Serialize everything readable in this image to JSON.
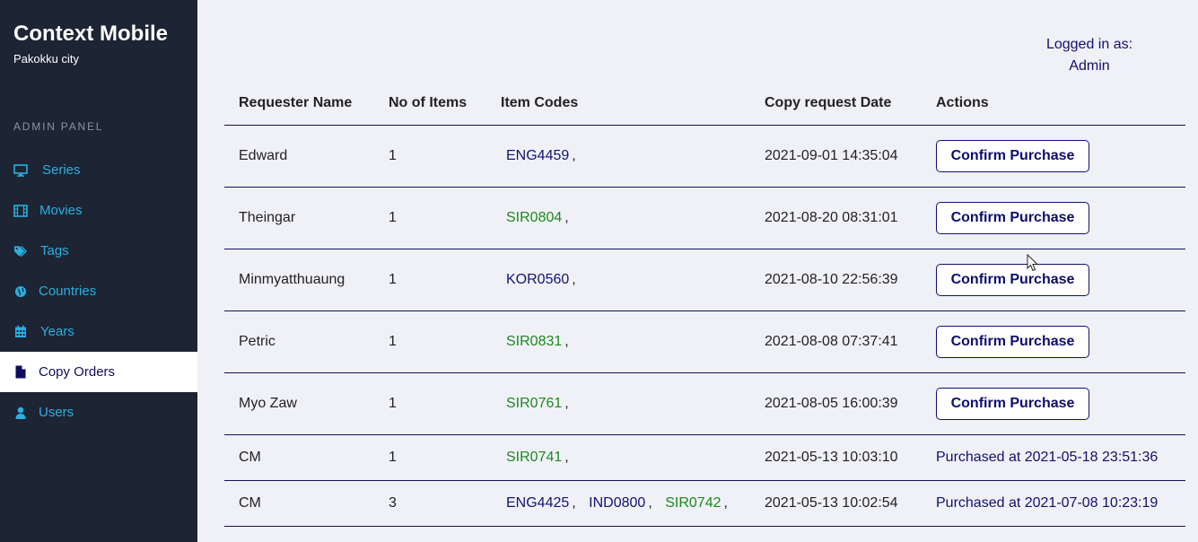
{
  "app": {
    "title": "Context Mobile",
    "subtitle": "Pakokku city"
  },
  "sidebar": {
    "section_label": "ADMIN PANEL",
    "items": [
      {
        "label": "Series",
        "icon": "monitor-icon"
      },
      {
        "label": "Movies",
        "icon": "film-icon"
      },
      {
        "label": "Tags",
        "icon": "tags-icon"
      },
      {
        "label": "Countries",
        "icon": "globe-icon"
      },
      {
        "label": "Years",
        "icon": "calendar-icon"
      },
      {
        "label": "Copy Orders",
        "icon": "file-icon",
        "active": true
      },
      {
        "label": "Users",
        "icon": "user-icon"
      }
    ]
  },
  "header": {
    "login_label": "Logged in as:",
    "user": "Admin"
  },
  "table": {
    "columns": [
      "Requester Name",
      "No of Items",
      "Item Codes",
      "Copy request Date",
      "Actions"
    ],
    "rows": [
      {
        "name": "Edward",
        "count": "1",
        "codes": [
          {
            "code": "ENG4459",
            "color": "blue"
          }
        ],
        "date": "2021-09-01 14:35:04",
        "action": "Confirm Purchase"
      },
      {
        "name": "Theingar",
        "count": "1",
        "codes": [
          {
            "code": "SIR0804",
            "color": "green"
          }
        ],
        "date": "2021-08-20 08:31:01",
        "action": "Confirm Purchase"
      },
      {
        "name": "Minmyatthuaung",
        "count": "1",
        "codes": [
          {
            "code": "KOR0560",
            "color": "blue"
          }
        ],
        "date": "2021-08-10 22:56:39",
        "action": "Confirm Purchase"
      },
      {
        "name": "Petric",
        "count": "1",
        "codes": [
          {
            "code": "SIR0831",
            "color": "green"
          }
        ],
        "date": "2021-08-08 07:37:41",
        "action": "Confirm Purchase"
      },
      {
        "name": "Myo Zaw",
        "count": "1",
        "codes": [
          {
            "code": "SIR0761",
            "color": "green"
          }
        ],
        "date": "2021-08-05 16:00:39",
        "action": "Confirm Purchase"
      },
      {
        "name": "CM",
        "count": "1",
        "codes": [
          {
            "code": "SIR0741",
            "color": "green"
          }
        ],
        "date": "2021-05-13 10:03:10",
        "purchased": "Purchased at 2021-05-18 23:51:36"
      },
      {
        "name": "CM",
        "count": "3",
        "codes": [
          {
            "code": "ENG4425",
            "color": "blue"
          },
          {
            "code": "IND0800",
            "color": "blue"
          },
          {
            "code": "SIR0742",
            "color": "green"
          }
        ],
        "date": "2021-05-13 10:02:54",
        "purchased": "Purchased at 2021-07-08 10:23:19"
      }
    ]
  },
  "colors": {
    "sidebar_bg": "#1d2434",
    "nav_text": "#29b0e0",
    "code_blue": "#0f1478",
    "code_green": "#1b8a1b",
    "page_bg": "#f0f1f7"
  }
}
